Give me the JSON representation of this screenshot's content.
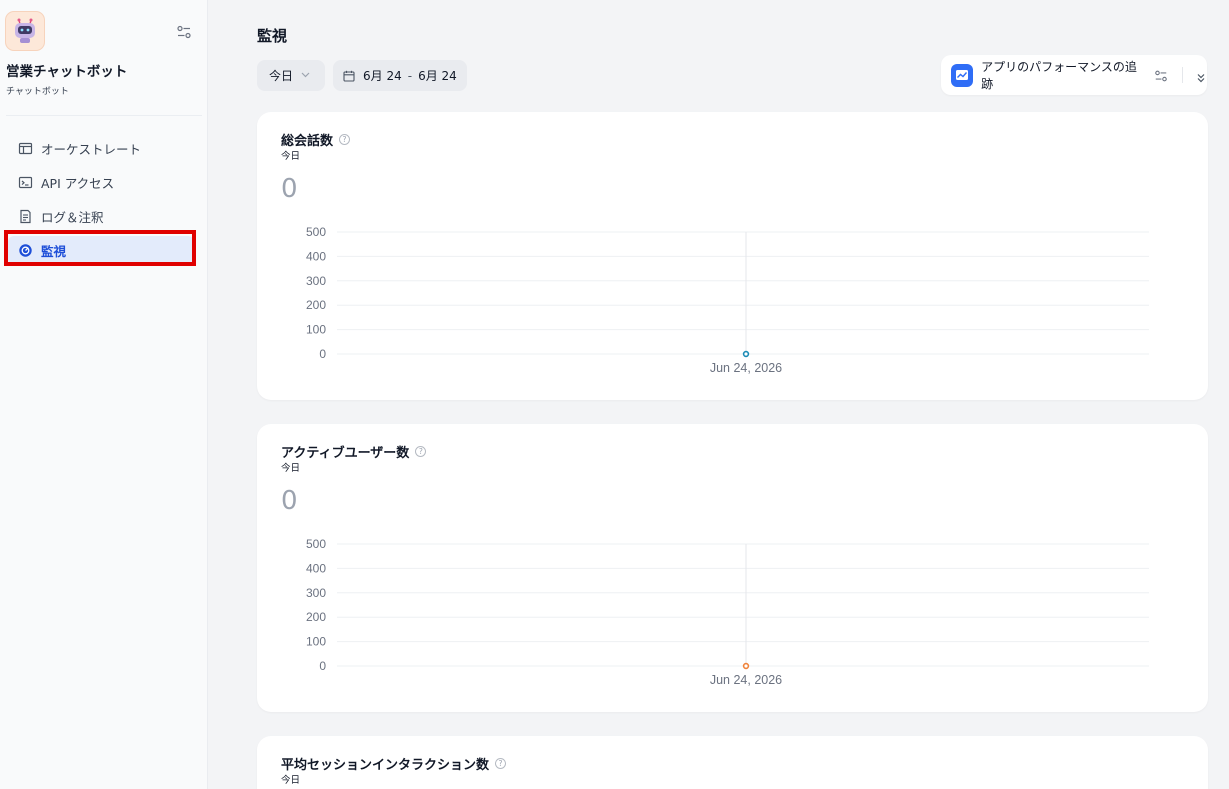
{
  "sidebar": {
    "app_name": "営業チャットボット",
    "app_type": "チャットボット",
    "items": [
      {
        "label": "オーケストレート",
        "icon": "layout-icon"
      },
      {
        "label": "API アクセス",
        "icon": "terminal-icon"
      },
      {
        "label": "ログ＆注釈",
        "icon": "document-icon"
      },
      {
        "label": "監視",
        "icon": "gauge-icon",
        "active": true
      }
    ]
  },
  "header": {
    "title": "監視",
    "period": "今日",
    "date_start": "6月 24",
    "date_sep": "-",
    "date_end": "6月 24",
    "tracking_label": "アプリのパフォーマンスの追跡"
  },
  "cards": [
    {
      "title": "総会話数",
      "subtitle": "今日",
      "value": "0"
    },
    {
      "title": "アクティブユーザー数",
      "subtitle": "今日",
      "value": "0"
    },
    {
      "title": "平均セッションインタラクション数",
      "subtitle": "今日"
    }
  ],
  "chart_data": [
    {
      "type": "line",
      "x": [
        "Jun 24, 2026"
      ],
      "series": [
        {
          "values": [
            0
          ],
          "color": "#1b8bb5"
        }
      ],
      "yticks": [
        "500",
        "400",
        "300",
        "200",
        "100",
        "0"
      ],
      "ylim": [
        0,
        500
      ],
      "grid": true
    },
    {
      "type": "line",
      "x": [
        "Jun 24, 2026"
      ],
      "series": [
        {
          "values": [
            0
          ],
          "color": "#f0833a"
        }
      ],
      "yticks": [
        "500",
        "400",
        "300",
        "200",
        "100",
        "0"
      ],
      "ylim": [
        0,
        500
      ],
      "grid": true
    }
  ]
}
